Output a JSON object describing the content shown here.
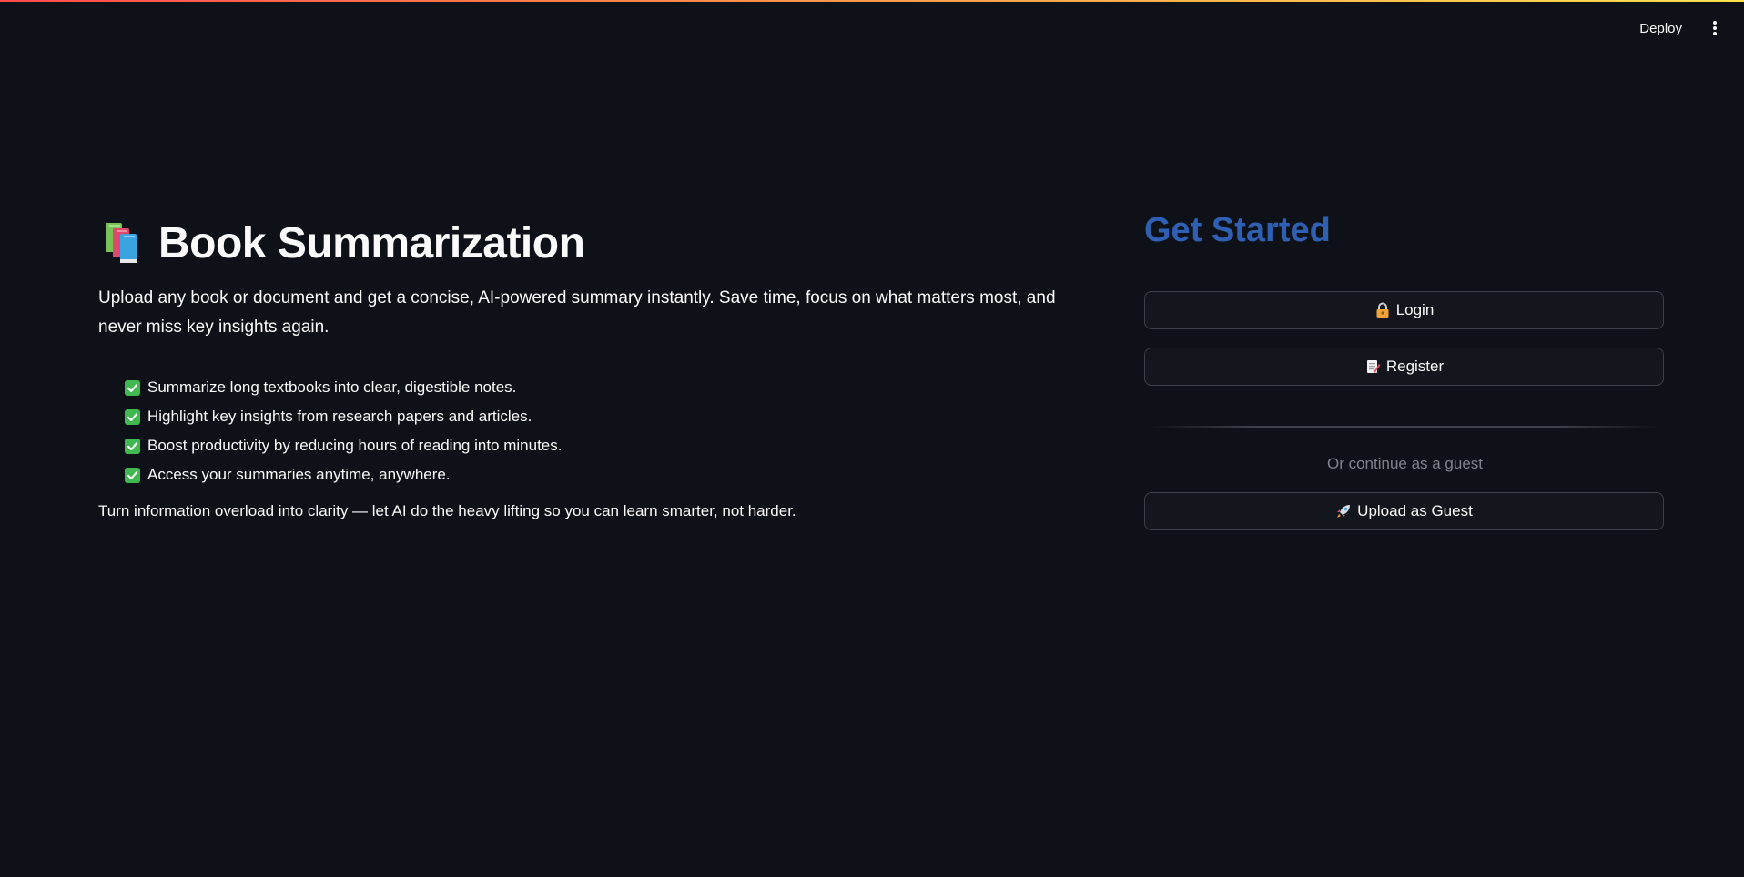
{
  "header": {
    "deploy_label": "Deploy",
    "menu_icon": "vertical-dots-icon"
  },
  "hero": {
    "icon": "books-icon",
    "title": "Book Summarization",
    "intro": "Upload any book or document and get a concise, AI-powered summary instantly. Save time, focus on what matters most, and never miss key insights again.",
    "features": [
      "Summarize long textbooks into clear, digestible notes.",
      "Highlight key insights from research papers and articles.",
      "Boost productivity by reducing hours of reading into minutes.",
      "Access your summaries anytime, anywhere."
    ],
    "closing": "Turn information overload into clarity — let AI do the heavy lifting so you can learn smarter, not harder."
  },
  "auth": {
    "title": "Get Started",
    "login_label": "Login",
    "register_label": "Register",
    "guest_caption": "Or continue as a guest",
    "guest_label": "Upload as Guest"
  },
  "colors": {
    "background": "#0e1117",
    "accent_title": "#2f5fb3",
    "check": "#3fb950",
    "caption": "#7d828b"
  }
}
